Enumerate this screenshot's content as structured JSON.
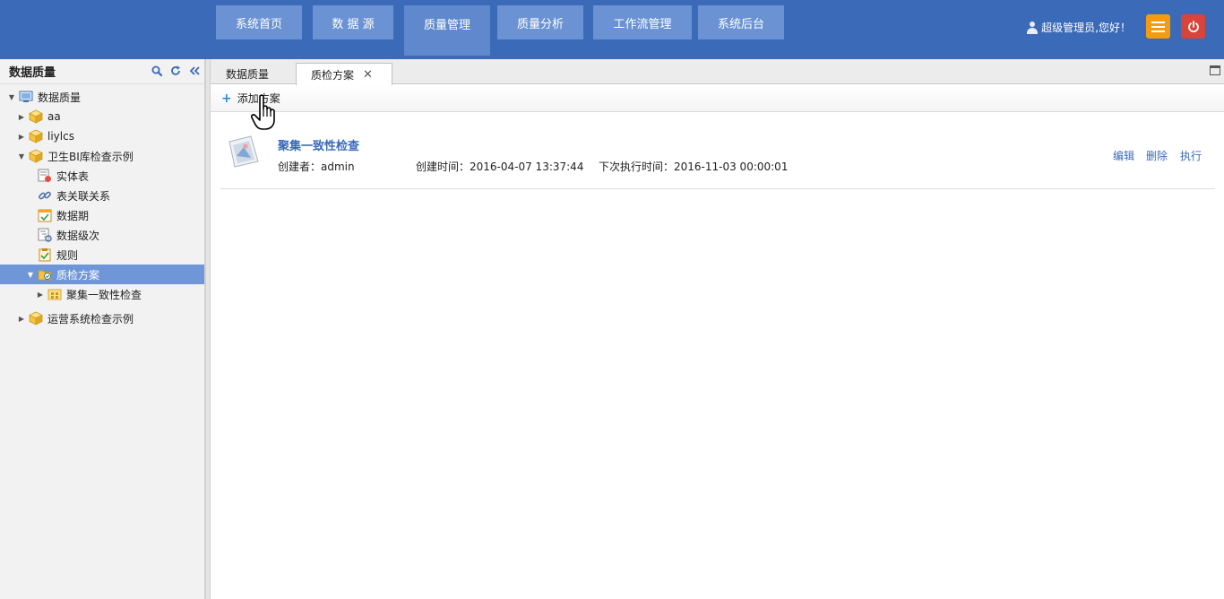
{
  "header": {
    "nav": [
      {
        "label": "系统首页"
      },
      {
        "label": "数 据 源"
      },
      {
        "label": "质量管理"
      },
      {
        "label": "质量分析"
      },
      {
        "label": "工作流管理"
      },
      {
        "label": "系统后台"
      }
    ],
    "active_nav": "质量管理",
    "greeting": "超级管理员,您好！",
    "menu_icon": "hamburger-icon",
    "power_icon": "power-icon",
    "colors": {
      "bar": "#3a6ab8",
      "nav_button": "#6b93d3",
      "menu_button": "#f39c12",
      "power_button": "#d9443a"
    }
  },
  "left_panel": {
    "title": "数据质量",
    "tools": [
      "search-icon",
      "refresh-icon",
      "collapse-icon"
    ],
    "tree": [
      {
        "label": "数据质量",
        "icon": "monitor-icon",
        "expanded": true
      },
      {
        "label": "aa",
        "icon": "cube-icon",
        "expanded": false
      },
      {
        "label": "liylcs",
        "icon": "cube-icon",
        "expanded": false
      },
      {
        "label": "卫生BI库检查示例",
        "icon": "cube-icon",
        "expanded": true
      },
      {
        "label": "实体表",
        "icon": "entity-table-icon"
      },
      {
        "label": "表关联关系",
        "icon": "link-icon"
      },
      {
        "label": "数据期",
        "icon": "calendar-icon"
      },
      {
        "label": "数据级次",
        "icon": "level-icon"
      },
      {
        "label": "规则",
        "icon": "rule-icon"
      },
      {
        "label": "质检方案",
        "icon": "folder-check-icon",
        "expanded": true,
        "selected": true
      },
      {
        "label": "聚集一致性检查",
        "icon": "plan-icon",
        "expanded": false
      },
      {
        "label": "运营系统检查示例",
        "icon": "cube-icon",
        "expanded": false
      }
    ]
  },
  "tabs": [
    {
      "label": "数据质量"
    },
    {
      "label": "质检方案",
      "active": true,
      "close": "✕"
    }
  ],
  "toolbar": {
    "add_label": "添加方案",
    "add_icon": "plus-icon"
  },
  "plan": {
    "title": "聚集一致性检查",
    "creator": "创建者：admin",
    "created_time": "创建时间：2016-04-07 13:37:44",
    "next_run": "下次执行时间：2016-11-03 00:00:01",
    "actions": {
      "edit": "编辑",
      "delete": "删除",
      "run": "执行"
    }
  }
}
